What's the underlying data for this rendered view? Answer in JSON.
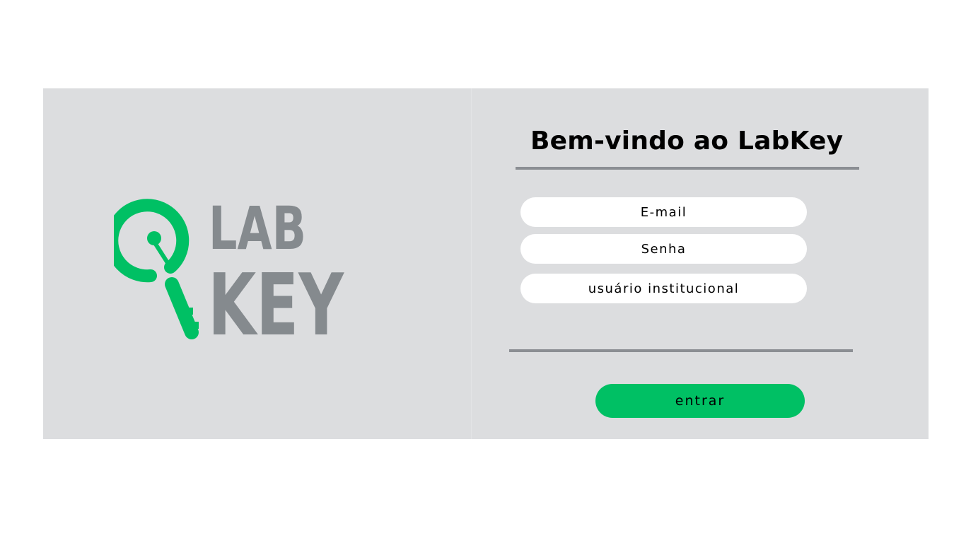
{
  "logo": {
    "line1": "LAB",
    "line2": "KEY",
    "icon": "key-icon",
    "colors": {
      "green": "#00c064",
      "gray": "#858a8e"
    }
  },
  "login": {
    "title": "Bem-vindo ao LabKey",
    "fields": {
      "email_placeholder": "E-mail",
      "password_placeholder": "Senha",
      "institutional_placeholder": "usuário institucional"
    },
    "submit_label": "entrar"
  },
  "colors": {
    "card_background": "#dcdddf",
    "accent": "#00c064",
    "rule": "#8b8e93",
    "page_background": "#ffffff"
  }
}
